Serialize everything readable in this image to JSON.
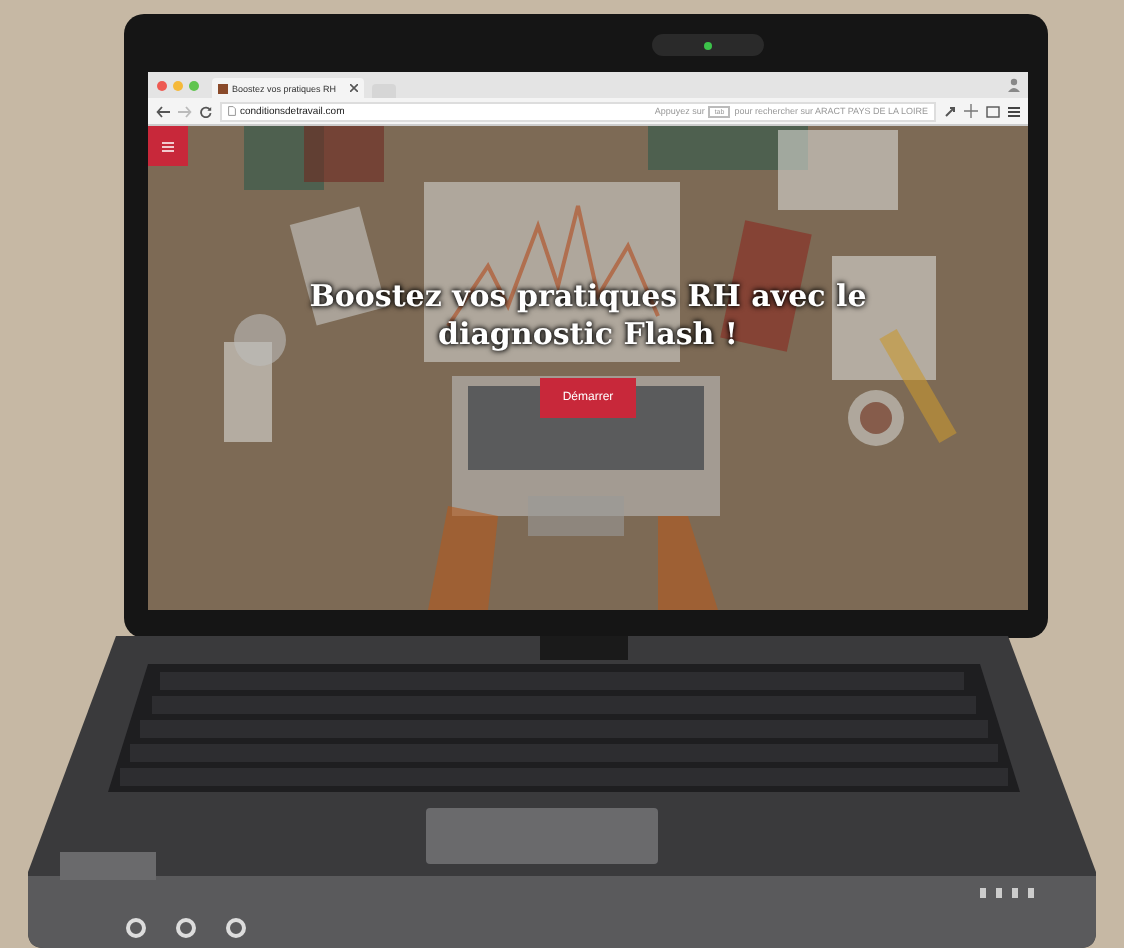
{
  "browser": {
    "tab_title": "Boostez vos pratiques RH",
    "address": "conditionsdetravail.com",
    "search_hint_before": "Appuyez sur",
    "search_key": "tab",
    "search_hint_after": "pour rechercher sur ARACT PAYS DE LA LOIRE"
  },
  "page": {
    "headline": "Boostez vos pratiques RH avec le diagnostic Flash !",
    "button": "Démarrer"
  }
}
